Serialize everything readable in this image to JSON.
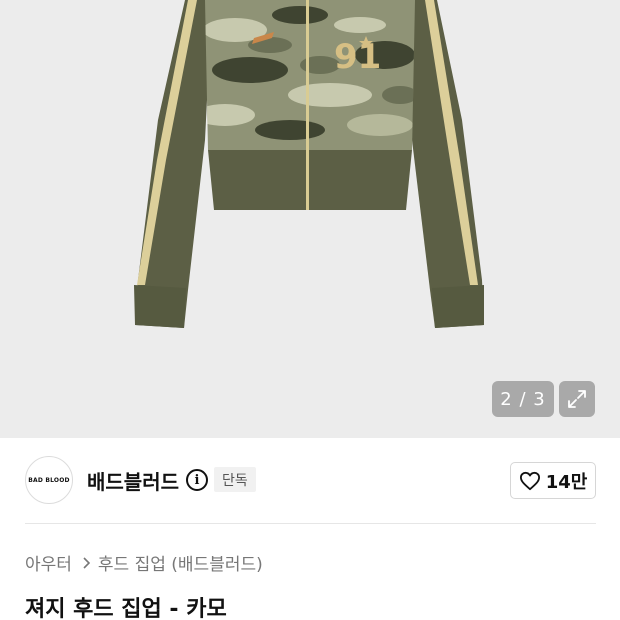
{
  "gallery": {
    "counter": "2 / 3",
    "colors": {
      "background": "#ececec",
      "olive": "#5c5f45",
      "cream_stripe": "#dccf9a",
      "camo_light": "#b5b89a",
      "camo_dark": "#3f4431",
      "patch": "#d6bf84"
    }
  },
  "brand": {
    "logo_text": "BAD BLOOD",
    "name": "배드블러드",
    "badge": "단독",
    "likes": "14만"
  },
  "breadcrumb": [
    "아우터",
    "후드 집업 (배드블러드)"
  ],
  "product": {
    "title": "져지 후드 집업 - 카모"
  }
}
